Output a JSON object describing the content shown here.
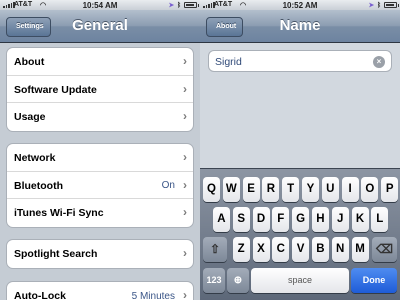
{
  "left_screen": {
    "status_bar": {
      "carrier": "AT&T",
      "time": "10:54 AM"
    },
    "nav": {
      "back_label": "Settings",
      "title": "General"
    },
    "groups": [
      [
        {
          "label": "About"
        },
        {
          "label": "Software Update"
        },
        {
          "label": "Usage"
        }
      ],
      [
        {
          "label": "Network"
        },
        {
          "label": "Bluetooth",
          "value": "On"
        },
        {
          "label": "iTunes Wi-Fi Sync"
        }
      ],
      [
        {
          "label": "Spotlight Search"
        }
      ],
      [
        {
          "label": "Auto-Lock",
          "value": "5 Minutes"
        }
      ]
    ]
  },
  "right_screen": {
    "status_bar": {
      "carrier": "AT&T",
      "time": "10:52 AM"
    },
    "nav": {
      "back_label": "About",
      "title": "Name"
    },
    "name_field": {
      "value": "Sigrid"
    },
    "keyboard": {
      "row1": [
        "Q",
        "W",
        "E",
        "R",
        "T",
        "Y",
        "U",
        "I",
        "O",
        "P"
      ],
      "row2": [
        "A",
        "S",
        "D",
        "F",
        "G",
        "H",
        "J",
        "K",
        "L"
      ],
      "row3": [
        "Z",
        "X",
        "C",
        "V",
        "B",
        "N",
        "M"
      ],
      "numbers_label": "123",
      "space_label": "space",
      "done_label": "Done"
    }
  },
  "colors": {
    "nav_gradient_top": "#b3bfcd",
    "nav_gradient_bottom": "#6d83a0",
    "value_text": "#3a5587",
    "done_blue": "#1e5cd8"
  }
}
